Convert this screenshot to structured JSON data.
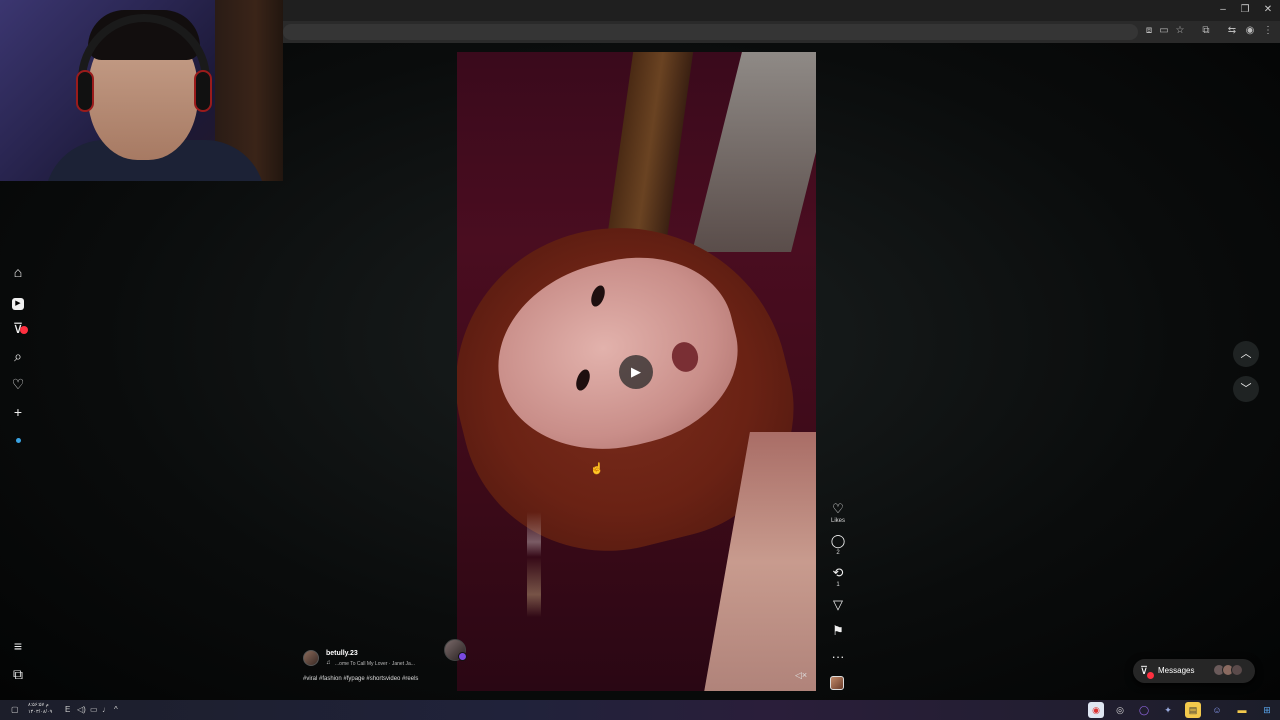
{
  "window": {
    "minimize_glyph": "–",
    "maximize_glyph": "❐",
    "close_glyph": "✕"
  },
  "toolbar_icons": [
    "translate-icon",
    "cast-icon",
    "bookmark-star-icon",
    "extensions-icon",
    "profile-icon",
    "settings-icon",
    "account-icon",
    "menu-icon"
  ],
  "left_rail": [
    {
      "name": "home-icon",
      "glyph": "⌂"
    },
    {
      "name": "reels-icon",
      "glyph": "▶"
    },
    {
      "name": "messages-icon",
      "glyph": "⊽",
      "badge": "3"
    },
    {
      "name": "search-icon",
      "glyph": "⌕"
    },
    {
      "name": "notifications-icon",
      "glyph": "♡"
    },
    {
      "name": "create-icon",
      "glyph": "+"
    },
    {
      "name": "more-icon",
      "glyph": "≡"
    },
    {
      "name": "meta-icon",
      "glyph": "⧉"
    }
  ],
  "video": {
    "play_glyph": "▶",
    "mute_glyph": "🔇"
  },
  "actions": {
    "like_glyph": "♡",
    "like_label": "Likes",
    "comment_glyph": "◯",
    "comment_count": "2",
    "repost_glyph": "⟲",
    "repost_count": "1",
    "share_glyph": "▽",
    "save_glyph": "⚑",
    "more_glyph": "···"
  },
  "caption": {
    "username": "betully.23",
    "song_icon": "♫",
    "song": "...ome To Call My Lover · Janet Ja...",
    "hashtags": "#viral #fashion #fypage #shortsvideo #reels"
  },
  "nav": {
    "up_glyph": "︿",
    "down_glyph": "﹀"
  },
  "messages": {
    "label": "Messages",
    "badge": "3"
  },
  "taskbar": {
    "clock": "م ۸:۵۶:۵۷\n۱۴۰۳/۰۸/۰۹",
    "lang": "E"
  },
  "colors": {
    "accent_red": "#ff3040",
    "page_bg": "#0a0c0c",
    "video_tint": "#3a0a1c"
  }
}
